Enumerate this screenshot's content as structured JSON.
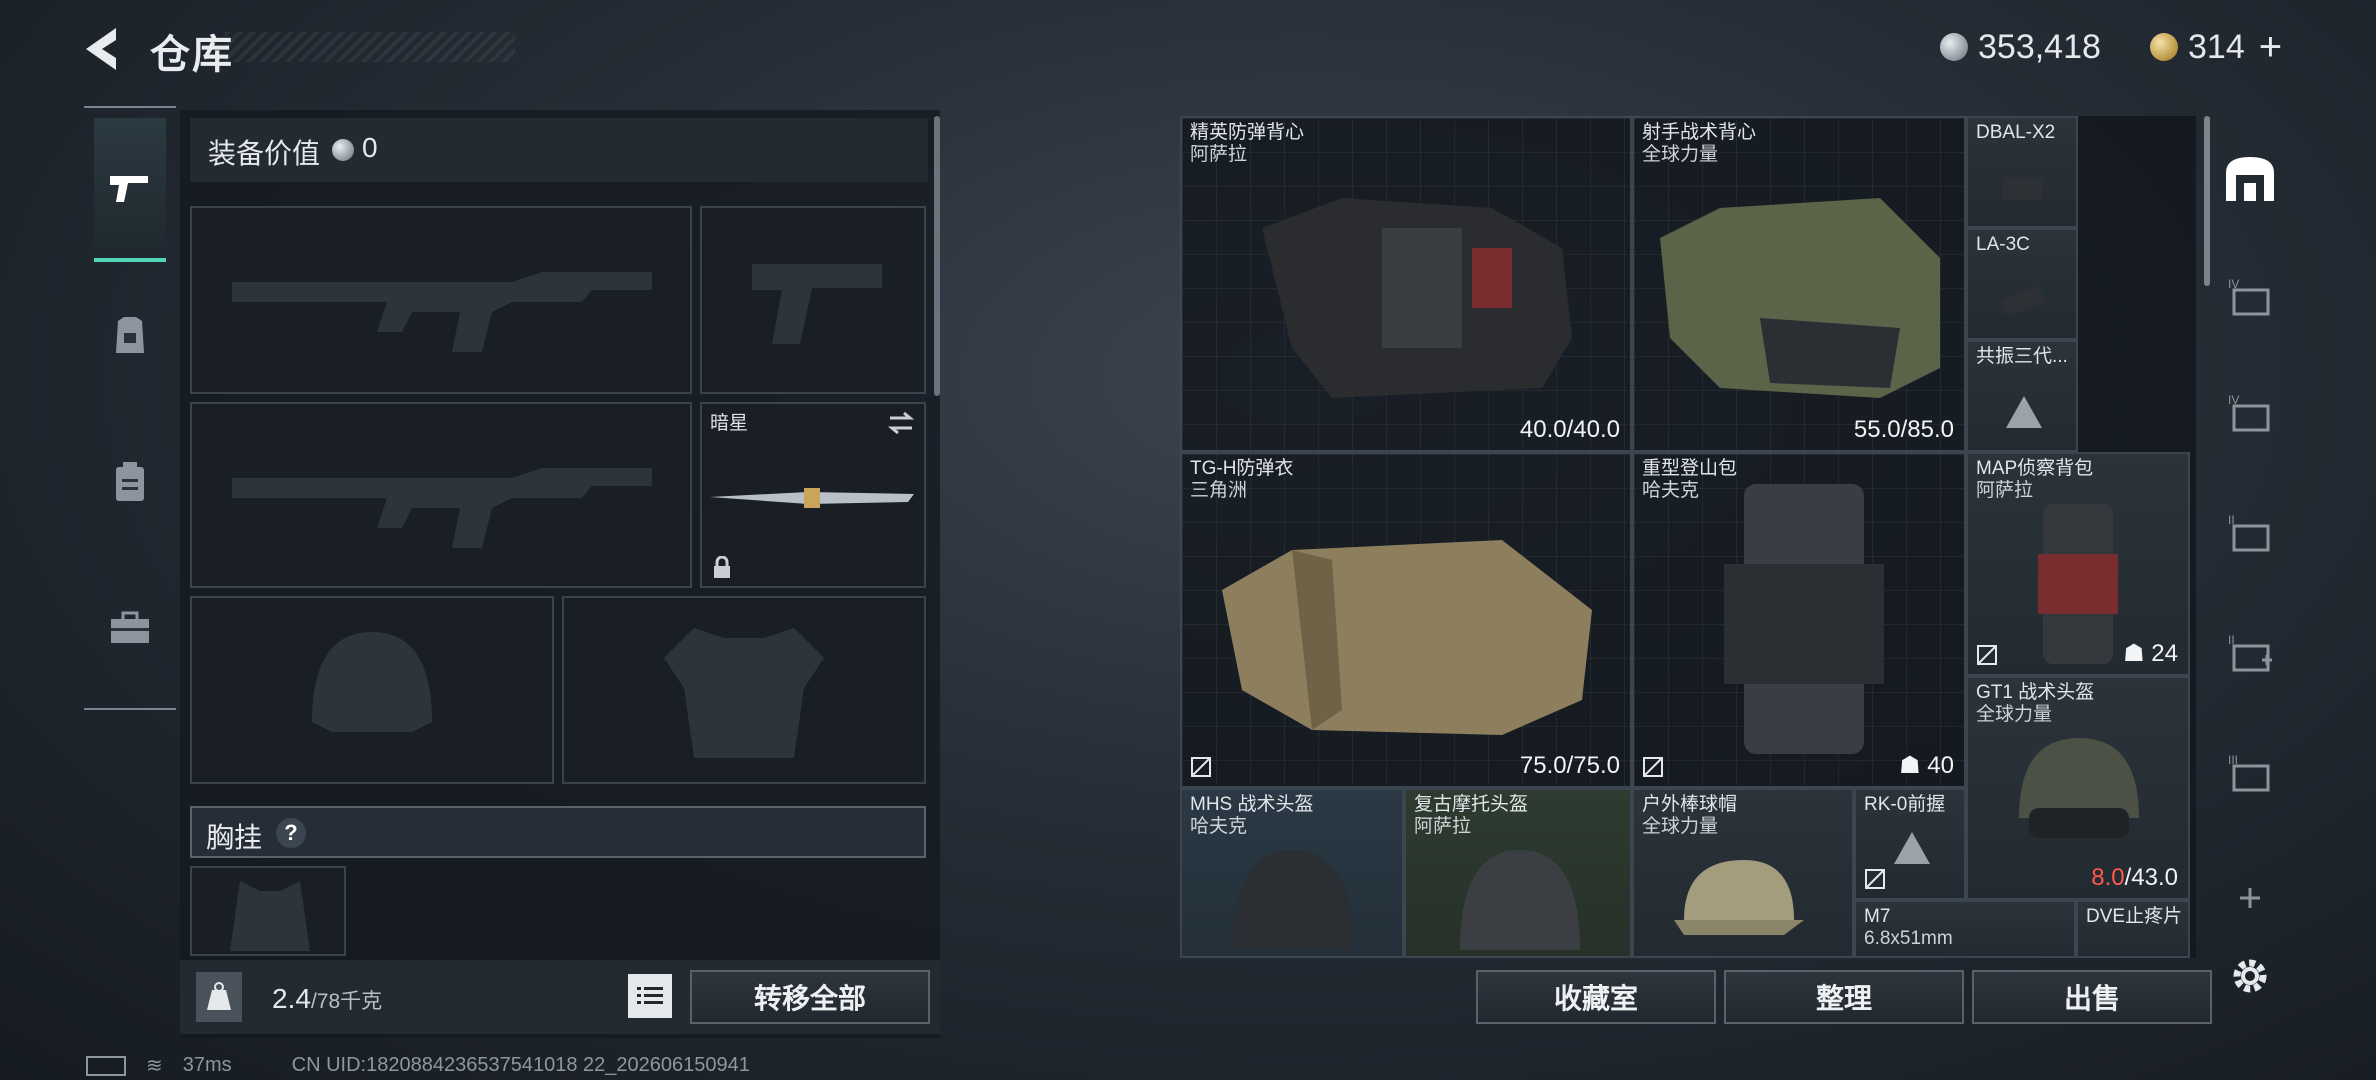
{
  "header": {
    "title": "仓库",
    "currency_silver": "353,418",
    "currency_gold": "314",
    "add_label": "+"
  },
  "loadout": {
    "value_label": "装备价值",
    "value_amount": "0",
    "secondary_weapon_name": "暗星",
    "chest_rig_label": "胸挂",
    "chest_rig_help": "?",
    "weight_current": "2.4",
    "weight_max": "/78千克",
    "transfer_all": "转移全部"
  },
  "status_bar": {
    "ping": "37ms",
    "uid": "CN UID:1820884236537541018 22_202606150941"
  },
  "storage": {
    "items": [
      {
        "name": "精英防弹背心",
        "maker": "阿萨拉",
        "durability": "40.0/40.0"
      },
      {
        "name": "射手战术背心",
        "maker": "全球力量",
        "durability": "55.0/85.0"
      },
      {
        "name": "DBAL-X2",
        "maker": ""
      },
      {
        "name": "LA-3C",
        "maker": ""
      },
      {
        "name": "共振三代...",
        "maker": ""
      },
      {
        "name": "TG-H防弹衣",
        "maker": "三角洲",
        "durability": "75.0/75.0"
      },
      {
        "name": "重型登山包",
        "maker": "哈夫克",
        "capacity": "40"
      },
      {
        "name": "MAP侦察背包",
        "maker": "阿萨拉",
        "capacity": "24"
      },
      {
        "name": "GT1 战术头盔",
        "maker": "全球力量",
        "durability_low": "8.0",
        "durability_max": "/43.0"
      },
      {
        "name": "MHS 战术头盔",
        "maker": "哈夫克"
      },
      {
        "name": "复古摩托头盔",
        "maker": "阿萨拉"
      },
      {
        "name": "户外棒球帽",
        "maker": "全球力量"
      },
      {
        "name": "RK-0前握",
        "maker": ""
      },
      {
        "name": "M7",
        "maker": "6.8x51mm"
      },
      {
        "name": "DVE止疼片",
        "maker": ""
      }
    ],
    "buttons": {
      "collection": "收藏室",
      "organize": "整理",
      "sell": "出售"
    }
  },
  "colors": {
    "accent_teal": "#52d4b7",
    "low_durability_red": "#ff5a4d"
  }
}
